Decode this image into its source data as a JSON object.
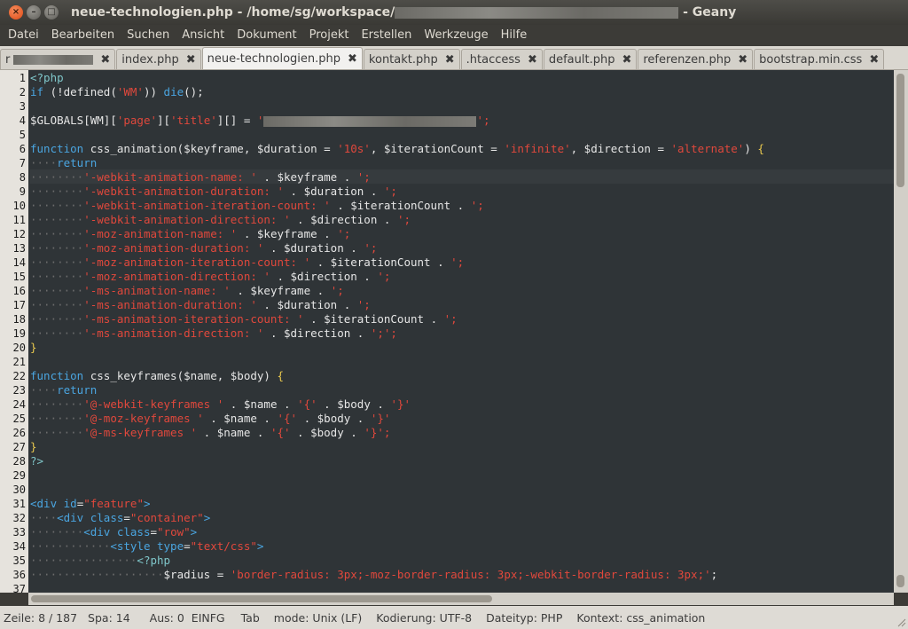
{
  "window": {
    "title_prefix": "neue-technologien.php - /home/sg/workspace/",
    "title_suffix": "- Geany"
  },
  "menu": [
    "Datei",
    "Bearbeiten",
    "Suchen",
    "Ansicht",
    "Dokument",
    "Projekt",
    "Erstellen",
    "Werkzeuge",
    "Hilfe"
  ],
  "tabs": [
    {
      "label": "r",
      "active": false,
      "blurred": true
    },
    {
      "label": "index.php",
      "active": false
    },
    {
      "label": "neue-technologien.php",
      "active": true
    },
    {
      "label": "kontakt.php",
      "active": false
    },
    {
      "label": ".htaccess",
      "active": false
    },
    {
      "label": "default.php",
      "active": false
    },
    {
      "label": "referenzen.php",
      "active": false
    },
    {
      "label": "bootstrap.min.css",
      "active": false
    }
  ],
  "code_lines": [
    [
      [
        "c",
        "<?php"
      ]
    ],
    [
      [
        "k",
        "if"
      ],
      [
        "v",
        " (!defined("
      ],
      [
        "s",
        "'WM'"
      ],
      [
        "v",
        ")) "
      ],
      [
        "k",
        "die"
      ],
      [
        "v",
        "();"
      ]
    ],
    [],
    [
      [
        "v",
        "$GLOBALS[WM]["
      ],
      [
        "s",
        "'page'"
      ],
      [
        "v",
        "]["
      ],
      [
        "s",
        "'title'"
      ],
      [
        "v",
        "][] = "
      ],
      [
        "s",
        "'"
      ],
      [
        "b",
        ""
      ],
      [
        "s",
        "';"
      ]
    ],
    [],
    [
      [
        "k",
        "function"
      ],
      [
        "v",
        " css_animation($keyframe, $duration = "
      ],
      [
        "s",
        "'10s'"
      ],
      [
        "v",
        ", $iterationCount = "
      ],
      [
        "s",
        "'infinite'"
      ],
      [
        "v",
        ", $direction = "
      ],
      [
        "s",
        "'alternate'"
      ],
      [
        "v",
        ") "
      ],
      [
        "p",
        "{"
      ]
    ],
    [
      [
        "d",
        "····"
      ],
      [
        "k",
        "return"
      ]
    ],
    [
      [
        "d",
        "········"
      ],
      [
        "s",
        "'-webkit-animation-name: '"
      ],
      [
        "v",
        " . $keyframe . "
      ],
      [
        "s",
        "';"
      ]
    ],
    [
      [
        "d",
        "········"
      ],
      [
        "s",
        "'-webkit-animation-duration: '"
      ],
      [
        "v",
        " . $duration . "
      ],
      [
        "s",
        "';"
      ]
    ],
    [
      [
        "d",
        "········"
      ],
      [
        "s",
        "'-webkit-animation-iteration-count: '"
      ],
      [
        "v",
        " . $iterationCount . "
      ],
      [
        "s",
        "';"
      ]
    ],
    [
      [
        "d",
        "········"
      ],
      [
        "s",
        "'-webkit-animation-direction: '"
      ],
      [
        "v",
        " . $direction . "
      ],
      [
        "s",
        "';"
      ]
    ],
    [
      [
        "d",
        "········"
      ],
      [
        "s",
        "'-moz-animation-name: '"
      ],
      [
        "v",
        " . $keyframe . "
      ],
      [
        "s",
        "';"
      ]
    ],
    [
      [
        "d",
        "········"
      ],
      [
        "s",
        "'-moz-animation-duration: '"
      ],
      [
        "v",
        " . $duration . "
      ],
      [
        "s",
        "';"
      ]
    ],
    [
      [
        "d",
        "········"
      ],
      [
        "s",
        "'-moz-animation-iteration-count: '"
      ],
      [
        "v",
        " . $iterationCount . "
      ],
      [
        "s",
        "';"
      ]
    ],
    [
      [
        "d",
        "········"
      ],
      [
        "s",
        "'-moz-animation-direction: '"
      ],
      [
        "v",
        " . $direction . "
      ],
      [
        "s",
        "';"
      ]
    ],
    [
      [
        "d",
        "········"
      ],
      [
        "s",
        "'-ms-animation-name: '"
      ],
      [
        "v",
        " . $keyframe . "
      ],
      [
        "s",
        "';"
      ]
    ],
    [
      [
        "d",
        "········"
      ],
      [
        "s",
        "'-ms-animation-duration: '"
      ],
      [
        "v",
        " . $duration . "
      ],
      [
        "s",
        "';"
      ]
    ],
    [
      [
        "d",
        "········"
      ],
      [
        "s",
        "'-ms-animation-iteration-count: '"
      ],
      [
        "v",
        " . $iterationCount . "
      ],
      [
        "s",
        "';"
      ]
    ],
    [
      [
        "d",
        "········"
      ],
      [
        "s",
        "'-ms-animation-direction: '"
      ],
      [
        "v",
        " . $direction . "
      ],
      [
        "s",
        "';';"
      ]
    ],
    [
      [
        "p",
        "}"
      ]
    ],
    [],
    [
      [
        "k",
        "function"
      ],
      [
        "v",
        " css_keyframes($name, $body) "
      ],
      [
        "p",
        "{"
      ]
    ],
    [
      [
        "d",
        "····"
      ],
      [
        "k",
        "return"
      ]
    ],
    [
      [
        "d",
        "········"
      ],
      [
        "s",
        "'@-webkit-keyframes '"
      ],
      [
        "v",
        " . $name . "
      ],
      [
        "s",
        "'{'"
      ],
      [
        "v",
        " . $body . "
      ],
      [
        "s",
        "'}'"
      ]
    ],
    [
      [
        "d",
        "········"
      ],
      [
        "s",
        "'@-moz-keyframes '"
      ],
      [
        "v",
        " . $name . "
      ],
      [
        "s",
        "'{'"
      ],
      [
        "v",
        " . $body . "
      ],
      [
        "s",
        "'}'"
      ]
    ],
    [
      [
        "d",
        "········"
      ],
      [
        "s",
        "'@-ms-keyframes '"
      ],
      [
        "v",
        " . $name . "
      ],
      [
        "s",
        "'{'"
      ],
      [
        "v",
        " . $body . "
      ],
      [
        "s",
        "'}';"
      ]
    ],
    [
      [
        "p",
        "}"
      ]
    ],
    [
      [
        "c",
        "?>"
      ]
    ],
    [],
    [],
    [
      [
        "k",
        "<div"
      ],
      [
        "v",
        " "
      ],
      [
        "k",
        "id"
      ],
      [
        "v",
        "="
      ],
      [
        "s",
        "\"feature\""
      ],
      [
        "k",
        ">"
      ]
    ],
    [
      [
        "d",
        "····"
      ],
      [
        "k",
        "<div"
      ],
      [
        "v",
        " "
      ],
      [
        "k",
        "class"
      ],
      [
        "v",
        "="
      ],
      [
        "s",
        "\"container\""
      ],
      [
        "k",
        ">"
      ]
    ],
    [
      [
        "d",
        "········"
      ],
      [
        "k",
        "<div"
      ],
      [
        "v",
        " "
      ],
      [
        "k",
        "class"
      ],
      [
        "v",
        "="
      ],
      [
        "s",
        "\"row\""
      ],
      [
        "k",
        ">"
      ]
    ],
    [
      [
        "d",
        "············"
      ],
      [
        "k",
        "<style"
      ],
      [
        "v",
        " "
      ],
      [
        "k",
        "type"
      ],
      [
        "v",
        "="
      ],
      [
        "s",
        "\"text/css\""
      ],
      [
        "k",
        ">"
      ]
    ],
    [
      [
        "d",
        "················"
      ],
      [
        "c",
        "<?php"
      ]
    ],
    [
      [
        "d",
        "····················"
      ],
      [
        "v",
        "$radius = "
      ],
      [
        "s",
        "'border-radius: 3px;-moz-border-radius: 3px;-webkit-border-radius: 3px;'"
      ],
      [
        "v",
        ";"
      ]
    ],
    []
  ],
  "status": {
    "zeile": "Zeile: 8 / 187",
    "spalte": "Spa: 14",
    "aus": "Aus: 0",
    "einfg": "EINFG",
    "tab": "Tab",
    "mode": "mode: Unix (LF)",
    "kodierung": "Kodierung: UTF-8",
    "dateityp": "Dateityp: PHP",
    "kontext": "Kontext: css_animation"
  }
}
